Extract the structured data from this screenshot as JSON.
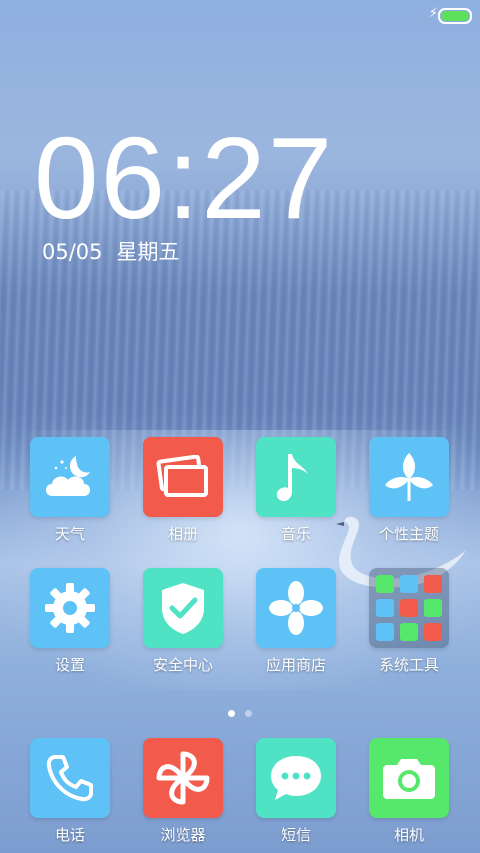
{
  "status_bar": {
    "charging_icon": "lightning-bolt",
    "battery_color": "#5be15b",
    "battery_level": 1.0
  },
  "clock": {
    "time": "06:27",
    "date": "05/05",
    "weekday": "星期五"
  },
  "apps": [
    {
      "label": "天气",
      "icon": "weather-cloud-moon",
      "color": "#5ec2f6"
    },
    {
      "label": "相册",
      "icon": "gallery-photos",
      "color": "#f25a4b"
    },
    {
      "label": "音乐",
      "icon": "music-note",
      "color": "#4fe2c5"
    },
    {
      "label": "个性主题",
      "icon": "theme-leaf",
      "color": "#5ec2f6"
    },
    {
      "label": "设置",
      "icon": "settings-gear",
      "color": "#5ec2f6"
    },
    {
      "label": "安全中心",
      "icon": "security-shield",
      "color": "#4fe2c5"
    },
    {
      "label": "应用商店",
      "icon": "app-store-pinwheel",
      "color": "#5ec2f6"
    },
    {
      "label": "系统工具",
      "icon": "folder-system-tools",
      "color": "#3b4f6e"
    }
  ],
  "dock": [
    {
      "label": "电话",
      "icon": "phone",
      "color": "#5ec2f6"
    },
    {
      "label": "浏览器",
      "icon": "browser-pinwheel",
      "color": "#f25a4b"
    },
    {
      "label": "短信",
      "icon": "message-bubble",
      "color": "#4fe2c5"
    },
    {
      "label": "相机",
      "icon": "camera",
      "color": "#56e86b"
    }
  ],
  "page_indicator": {
    "pages": 2,
    "current": 1
  }
}
